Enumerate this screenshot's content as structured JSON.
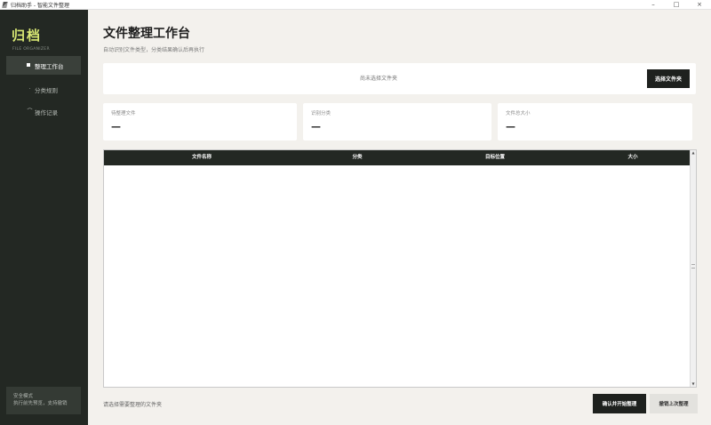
{
  "window": {
    "title": "归档助手 - 智能文件整理",
    "minimize": "–",
    "maximize": "□",
    "close": "×"
  },
  "sidebar": {
    "brand": "归档",
    "brand_sub": "FILE ORGANIZER",
    "items": [
      {
        "label": "整理工作台",
        "icon": "square-bullet-icon",
        "active": true
      },
      {
        "label": "分类规则",
        "icon": "dot-icon",
        "active": false
      },
      {
        "label": "操作记录",
        "icon": "arc-icon",
        "active": false
      }
    ],
    "safe_mode": {
      "title": "安全模式",
      "desc": "执行前先预览，支持撤销"
    }
  },
  "main": {
    "title": "文件整理工作台",
    "subtitle": "自动识别文件类型，分类结果确认后再执行",
    "folder": {
      "path_placeholder": "尚未选择文件夹",
      "choose_label": "选择文件夹"
    },
    "stats": [
      {
        "label": "待整理文件",
        "value": "—"
      },
      {
        "label": "识别分类",
        "value": "—"
      },
      {
        "label": "文件总大小",
        "value": "—"
      }
    ],
    "table": {
      "columns": [
        "文件名称",
        "分类",
        "目标位置",
        "大小"
      ],
      "rows": []
    },
    "hint": "请选择需要整理的文件夹",
    "confirm_label": "确认并开始整理",
    "undo_label": "撤销上次整理"
  },
  "colors": {
    "sidebar_bg": "#232823",
    "brand_accent": "#d9e874",
    "page_bg": "#f3f1ed",
    "primary_button": "#1e211e"
  }
}
